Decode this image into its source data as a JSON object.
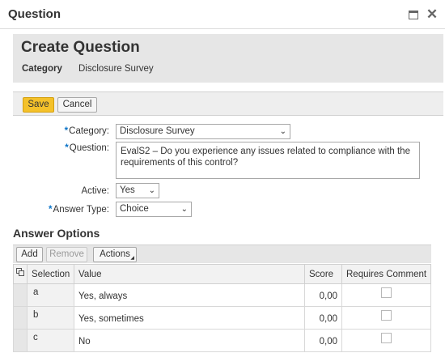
{
  "window": {
    "title": "Question",
    "maximize_icon": "maximize-icon",
    "close_icon": "close-icon",
    "close_glyph": "✕"
  },
  "header": {
    "title": "Create Question",
    "category_label": "Category",
    "category_value": "Disclosure Survey"
  },
  "toolbar": {
    "save_label": "Save",
    "cancel_label": "Cancel"
  },
  "form": {
    "required_marker": "*",
    "category_label": "Category:",
    "category_value": "Disclosure Survey",
    "question_label": "Question:",
    "question_value": "EvalS2 – Do you experience any issues related to compliance with the requirements of this control?",
    "active_label": "Active:",
    "active_value": "Yes",
    "answer_type_label": "Answer Type:",
    "answer_type_value": "Choice"
  },
  "answer_options": {
    "title": "Answer Options",
    "add_label": "Add",
    "remove_label": "Remove",
    "actions_label": "Actions",
    "columns": {
      "selection": "Selection",
      "value": "Value",
      "score": "Score",
      "requires_comment": "Requires Comment"
    },
    "rows": [
      {
        "selection": "a",
        "value": "Yes, always",
        "score": "0,00",
        "requires_comment": false
      },
      {
        "selection": "b",
        "value": "Yes, sometimes",
        "score": "0,00",
        "requires_comment": false
      },
      {
        "selection": "c",
        "value": "No",
        "score": "0,00",
        "requires_comment": false
      }
    ]
  },
  "colors": {
    "save_button": "#f4c12a",
    "required_marker": "#0a73c8",
    "header_background": "#e6e6e6"
  }
}
